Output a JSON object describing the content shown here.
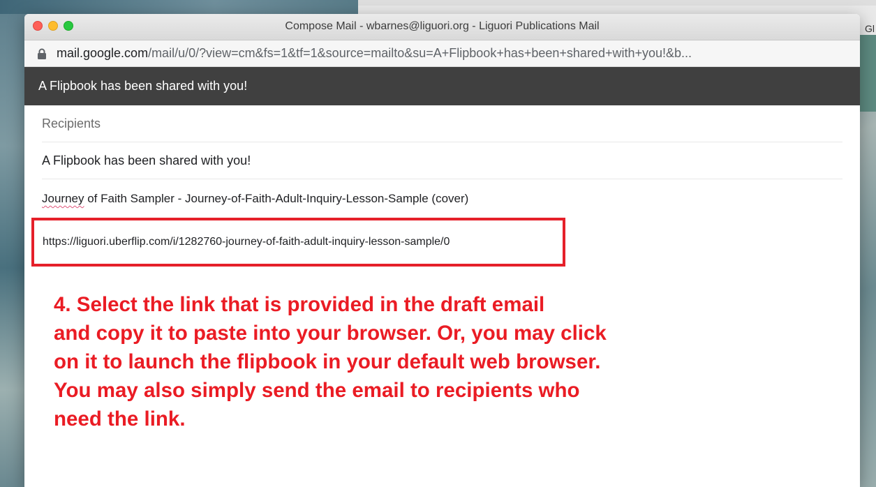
{
  "background_window": {
    "partial_text": "Gl"
  },
  "window": {
    "title": "Compose Mail - wbarnes@liguori.org - Liguori Publications Mail",
    "url_host": "mail.google.com",
    "url_path": "/mail/u/0/?view=cm&fs=1&tf=1&source=mailto&su=A+Flipbook+has+been+shared+with+you!&b..."
  },
  "compose": {
    "header_title": "A Flipbook has been shared with you!",
    "recipients_placeholder": "Recipients",
    "subject": "A Flipbook has been shared with you!",
    "body_first_word": "Journey",
    "body_rest": " of Faith Sampler - Journey-of-Faith-Adult-Inquiry-Lesson-Sample (cover)",
    "link": "https://liguori.uberflip.com/i/1282760-journey-of-faith-adult-inquiry-lesson-sample/0"
  },
  "annotation": {
    "text": "4. Select the link that is provided in the draft email\nand copy it to paste into your browser. Or, you may click\non it to launch the flipbook in your default web browser.\nYou may also simply send the email to recipients who\nneed the link.",
    "color": "#ea1c24"
  },
  "colors": {
    "header_bg": "#404040",
    "highlight_border": "#e5202a"
  }
}
